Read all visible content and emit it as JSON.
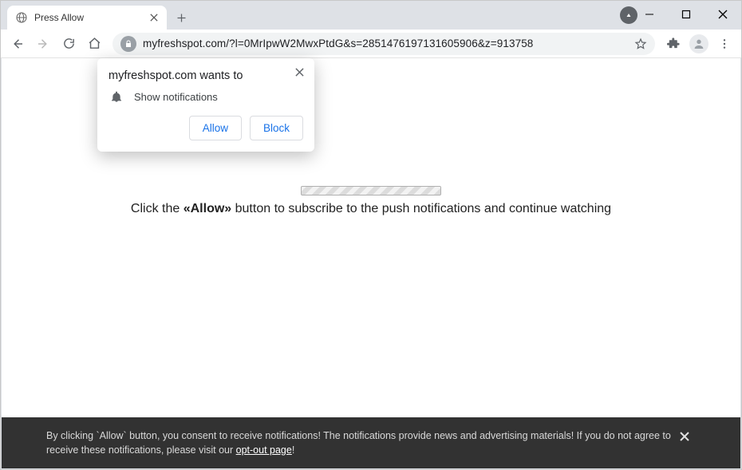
{
  "tab": {
    "title": "Press Allow"
  },
  "toolbar": {
    "url": "myfreshspot.com/?l=0MrIpwW2MwxPtdG&s=2851476197131605906&z=913758"
  },
  "permission": {
    "title": "myfreshspot.com wants to",
    "row_text": "Show notifications",
    "allow_label": "Allow",
    "block_label": "Block"
  },
  "page": {
    "message_prefix": "Click the ",
    "message_bold": "«Allow»",
    "message_suffix": " button to subscribe to the push notifications and continue watching"
  },
  "consent": {
    "text_before": "By clicking `Allow` button, you consent to receive notifications! The notifications provide news and advertising materials! If you do not agree to receive these notifications, please visit our ",
    "link_text": "opt-out page",
    "text_after": "!"
  }
}
